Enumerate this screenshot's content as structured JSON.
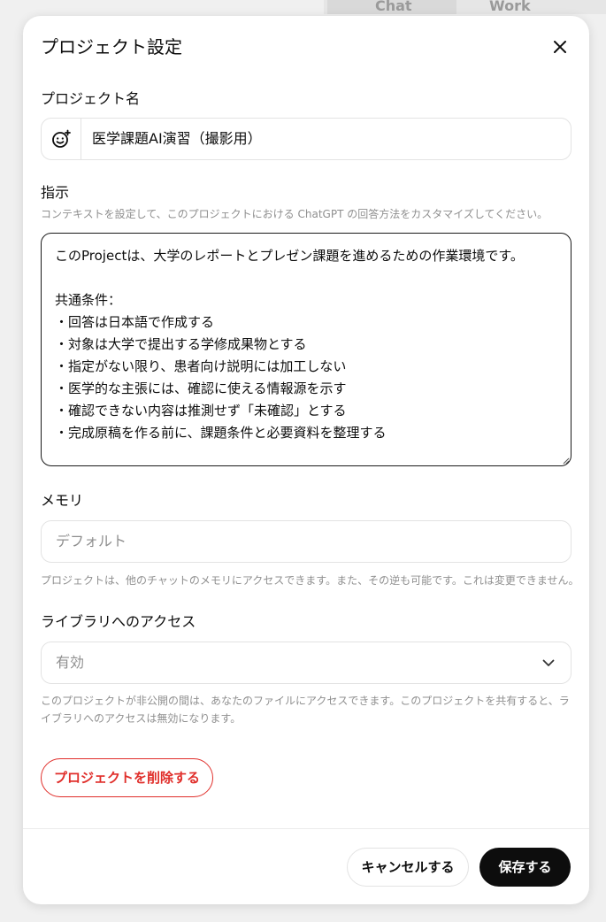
{
  "background": {
    "tab_chat": "Chat",
    "tab_work": "Work"
  },
  "dialog": {
    "title": "プロジェクト設定",
    "close_icon": "close-icon"
  },
  "project_name": {
    "label": "プロジェクト名",
    "icon": "smile-plus-icon",
    "value": "医学課題AI演習（撮影用）"
  },
  "instructions": {
    "label": "指示",
    "help": "コンテキストを設定して、このプロジェクトにおける ChatGPT の回答方法をカスタマイズしてください。",
    "value": "このProjectは、大学のレポートとプレゼン課題を進めるための作業環境です。\n\n共通条件：\n・回答は日本語で作成する\n・対象は大学で提出する学修成果物とする\n・指定がない限り、患者向け説明には加工しない\n・医学的な主張には、確認に使える情報源を示す\n・確認できない内容は推測せず「未確認」とする\n・完成原稿を作る前に、課題条件と必要資料を整理する"
  },
  "memory": {
    "label": "メモリ",
    "placeholder": "デフォルト",
    "help": "プロジェクトは、他のチャットのメモリにアクセスできます。また、その逆も可能です。これは変更できません。"
  },
  "library": {
    "label": "ライブラリへのアクセス",
    "selected": "有効",
    "help": "このプロジェクトが非公開の間は、あなたのファイルにアクセスできます。このプロジェクトを共有すると、ライブラリへのアクセスは無効になります。"
  },
  "actions": {
    "delete": "プロジェクトを削除する",
    "cancel": "キャンセルする",
    "save": "保存する"
  },
  "colors": {
    "danger": "#e02e2a",
    "primary": "#0d0d0d",
    "muted_text": "#8f8f8f"
  }
}
